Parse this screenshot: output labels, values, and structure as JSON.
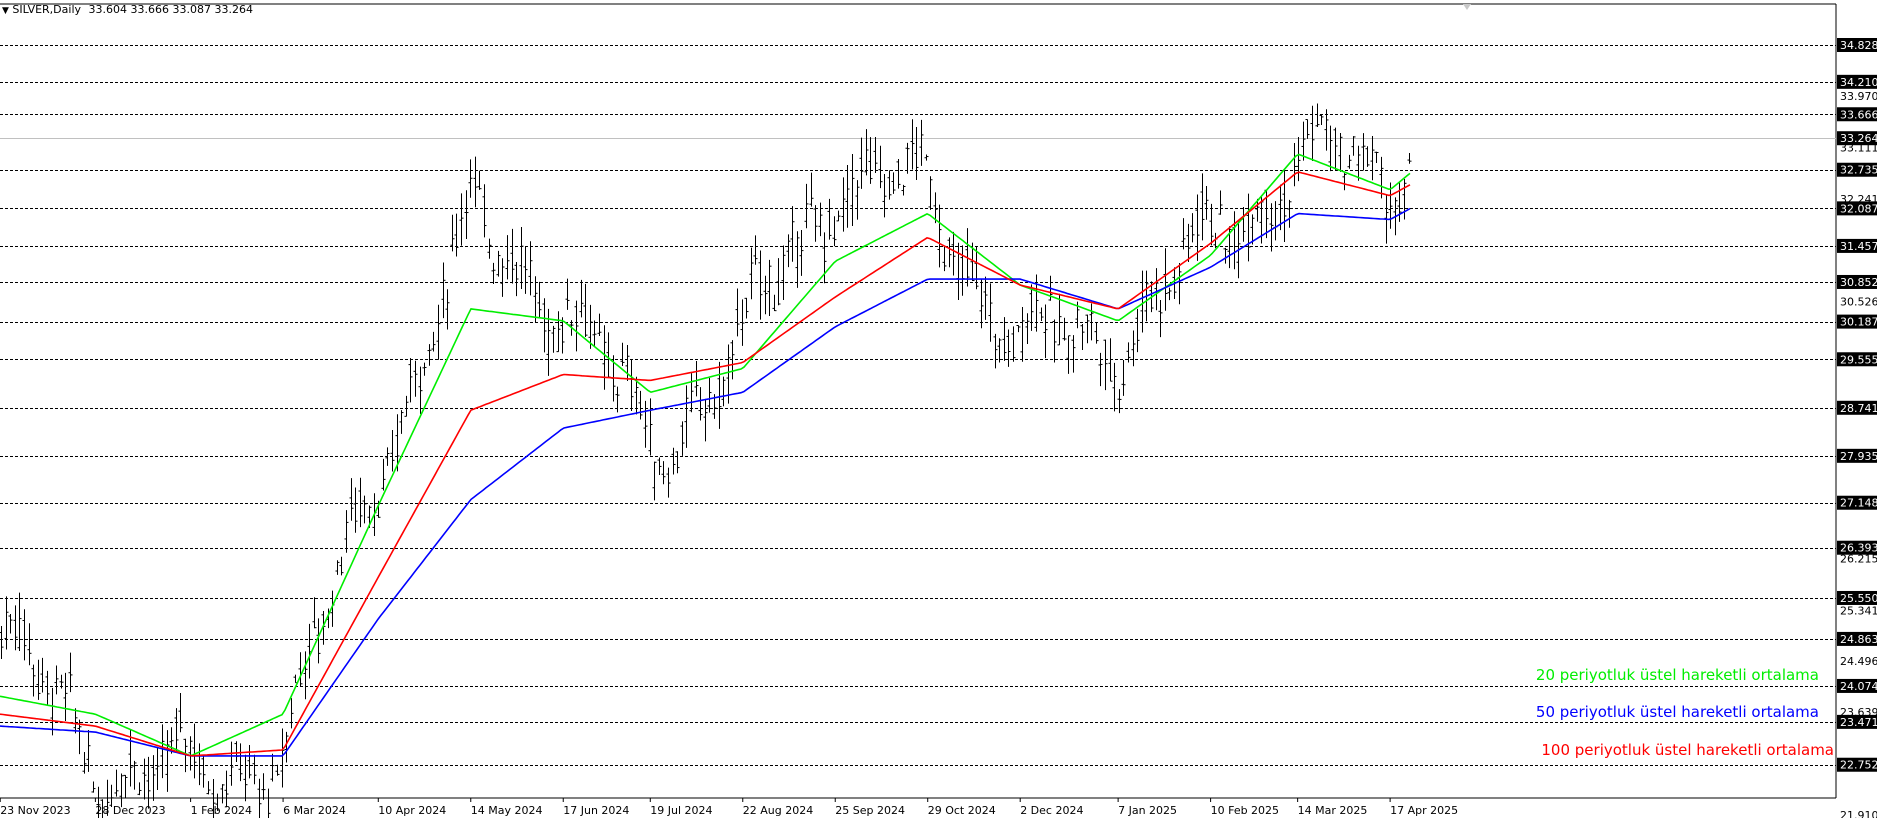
{
  "header": {
    "arrow_icon": "triangle-down-icon",
    "symbol": "SILVER,Daily",
    "ohlc": "33.604 33.666 33.087 33.264"
  },
  "colors": {
    "price_bars": "#000000",
    "ema20": "#00ee00",
    "ema50": "#0000ff",
    "ema100": "#ff0000",
    "grid": "#000000",
    "current_price_line": "#c0c0c0"
  },
  "legend": [
    {
      "label": "20 periyotluk üstel hareketli ortalama",
      "color": "#00ee00"
    },
    {
      "label": "50 periyotluk üstel hareketli ortalama",
      "color": "#0000ff"
    },
    {
      "label": "100 periyotluk üstel hareketli ortalama",
      "color": "#ff0000"
    }
  ],
  "chart_data": {
    "type": "line",
    "grid": true,
    "y_scale_labels": [
      "33.970",
      "33.111",
      "32.241",
      "30.526",
      "26.215",
      "25.341",
      "24.496",
      "23.639",
      "21.910"
    ],
    "price_tags": [
      "34.828",
      "34.210",
      "33.666",
      "33.264",
      "32.735",
      "32.087",
      "31.457",
      "30.852",
      "30.187",
      "29.555",
      "28.741",
      "27.935",
      "27.148",
      "26.393",
      "25.550",
      "24.863",
      "24.074",
      "23.471",
      "22.752"
    ],
    "horizontal_levels": [
      34.828,
      34.21,
      33.666,
      32.735,
      32.087,
      31.457,
      30.852,
      30.187,
      29.555,
      28.741,
      27.935,
      27.148,
      26.393,
      25.55,
      24.863,
      24.074,
      23.471,
      22.752
    ],
    "current_price": 33.264,
    "x_tick_labels": [
      "23 Nov 2023",
      "28 Dec 2023",
      "1 Feb 2024",
      "6 Mar 2024",
      "10 Apr 2024",
      "14 May 2024",
      "17 Jun 2024",
      "19 Jul 2024",
      "22 Aug 2024",
      "25 Sep 2024",
      "29 Oct 2024",
      "2 Dec 2024",
      "7 Jan 2025",
      "10 Feb 2025",
      "14 Mar 2025",
      "17 Apr 2025"
    ],
    "x": [
      "2023-11-23",
      "2023-12-28",
      "2024-02-01",
      "2024-03-06",
      "2024-04-10",
      "2024-05-14",
      "2024-06-17",
      "2024-07-19",
      "2024-08-22",
      "2024-09-25",
      "2024-10-29",
      "2024-12-02",
      "2025-01-07",
      "2025-02-10",
      "2025-03-14",
      "2025-04-17",
      "2025-04-25"
    ],
    "series": [
      {
        "name": "SILVER,Daily",
        "values": [
          24.9,
          22.9,
          22.5,
          23.0,
          27.8,
          31.8,
          30.6,
          28.0,
          29.8,
          32.6,
          32.3,
          29.8,
          30.0,
          31.5,
          33.0,
          32.5,
          33.26
        ]
      },
      {
        "name": "20 periyotluk üstel hareketli ortalama",
        "values": [
          23.9,
          23.6,
          22.9,
          23.6,
          27.1,
          30.4,
          30.2,
          29.0,
          29.4,
          31.2,
          32.0,
          30.8,
          30.2,
          31.3,
          33.0,
          32.4,
          32.7
        ]
      },
      {
        "name": "50 periyotluk üstel hareketli ortalama",
        "values": [
          23.4,
          23.3,
          22.9,
          22.9,
          25.2,
          27.2,
          28.4,
          28.7,
          29.0,
          30.1,
          30.9,
          30.9,
          30.4,
          31.1,
          32.0,
          31.9,
          32.1
        ]
      },
      {
        "name": "100 periyotluk üstel hareketli ortalama",
        "values": [
          23.6,
          23.4,
          22.9,
          23.0,
          25.9,
          28.7,
          29.3,
          29.2,
          29.5,
          30.6,
          31.6,
          30.8,
          30.4,
          31.5,
          32.7,
          32.3,
          32.5
        ]
      }
    ]
  }
}
